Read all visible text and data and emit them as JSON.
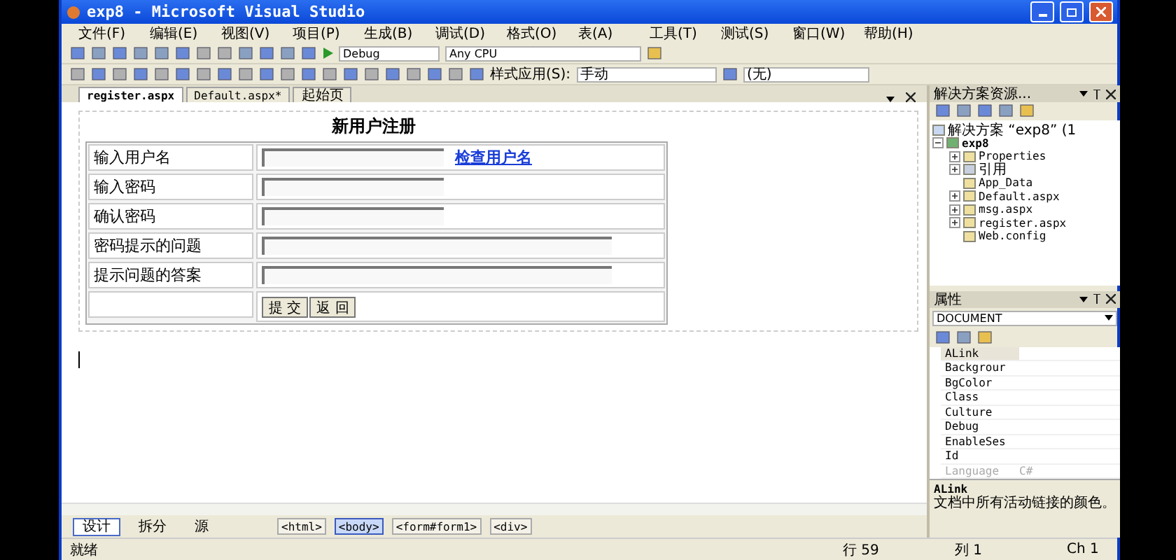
{
  "window": {
    "title": "exp8 - Microsoft Visual Studio"
  },
  "menu": [
    "文件(F)",
    "编辑(E)",
    "视图(V)",
    "项目(P)",
    "生成(B)",
    "调试(D)",
    "格式(O)",
    "表(A)",
    "工具(T)",
    "测试(S)",
    "窗口(W)",
    "帮助(H)"
  ],
  "toolbar": {
    "config": "Debug",
    "platform": "Any CPU",
    "style_label": "样式应用(S):",
    "style_value": "手动",
    "target_value": "(无)"
  },
  "editor": {
    "tabs": [
      {
        "label": "register.aspx",
        "selected": true
      },
      {
        "label": "Default.aspx*",
        "selected": false
      },
      {
        "label": "起始页",
        "selected": false
      }
    ],
    "form": {
      "title": "新用户注册",
      "rows": [
        {
          "label": "输入用户名",
          "kind": "short",
          "link": "检查用户名"
        },
        {
          "label": "输入密码",
          "kind": "short"
        },
        {
          "label": "确认密码",
          "kind": "short"
        },
        {
          "label": "密码提示的问题",
          "kind": "long"
        },
        {
          "label": "提示问题的答案",
          "kind": "long"
        }
      ],
      "buttons": [
        "提 交",
        "返 回"
      ]
    },
    "view_tabs": [
      {
        "label": "设计",
        "selected": true
      },
      {
        "label": "拆分",
        "selected": false
      },
      {
        "label": "源",
        "selected": false
      }
    ],
    "tag_path": [
      {
        "label": "<html>",
        "selected": false
      },
      {
        "label": "<body>",
        "selected": true
      },
      {
        "label": "<form#form1>",
        "selected": false
      },
      {
        "label": "<div>",
        "selected": false
      }
    ]
  },
  "solution_explorer": {
    "title": "解决方案资源...",
    "root": "解决方案 “exp8” (1",
    "project": {
      "label": "exp8",
      "expanded": true,
      "children": [
        {
          "label": "Properties",
          "collapsed": true
        },
        {
          "label": "引用",
          "collapsed": true
        },
        {
          "label": "App_Data",
          "collapsed": false
        },
        {
          "label": "Default.aspx",
          "collapsed": true
        },
        {
          "label": "msg.aspx",
          "collapsed": true
        },
        {
          "label": "register.aspx",
          "collapsed": true
        },
        {
          "label": "Web.config",
          "collapsed": false
        }
      ]
    }
  },
  "properties": {
    "title": "属性",
    "object": "DOCUMENT",
    "rows": [
      {
        "name": "ALink",
        "selected": true,
        "disabled": false
      },
      {
        "name": "Backgrour",
        "selected": false,
        "disabled": false
      },
      {
        "name": "BgColor",
        "selected": false,
        "disabled": false
      },
      {
        "name": "Class",
        "selected": false,
        "disabled": false
      },
      {
        "name": "Culture",
        "selected": false,
        "disabled": false
      },
      {
        "name": "Debug",
        "selected": false,
        "disabled": false
      },
      {
        "name": "EnableSes",
        "selected": false,
        "disabled": false
      },
      {
        "name": "Id",
        "selected": false,
        "disabled": false
      },
      {
        "name": "Language",
        "value": "C#",
        "selected": false,
        "disabled": true
      }
    ],
    "description_title": "ALink",
    "description": "文档中所有活动链接的颜色。"
  },
  "status_bar": {
    "message": "就绪",
    "line": "行 59",
    "col": "列 1",
    "ch": "Ch 1"
  }
}
